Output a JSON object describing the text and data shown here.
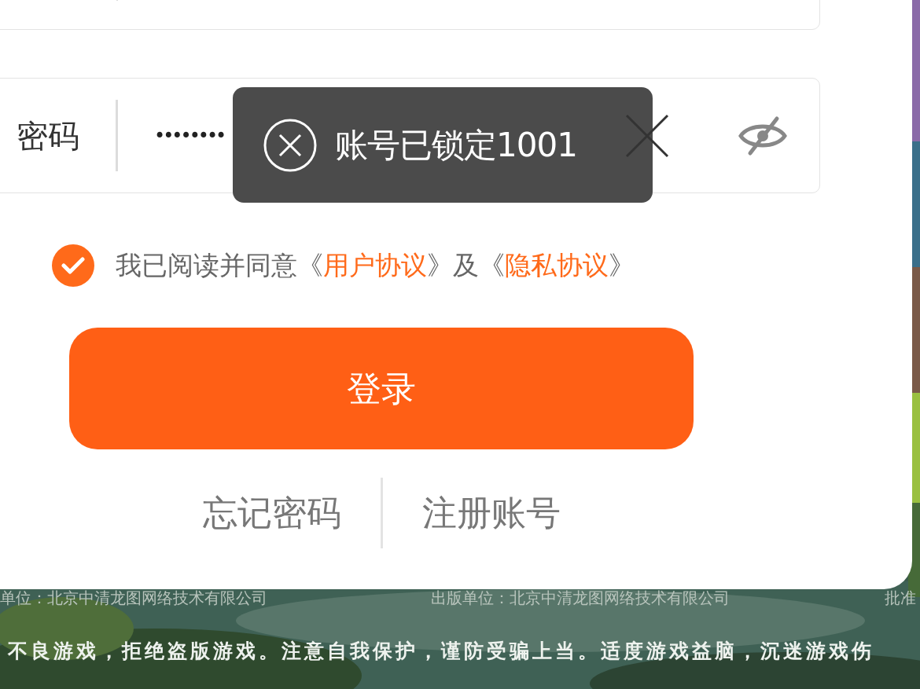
{
  "password_field": {
    "label": "密码",
    "value": "••••••••",
    "password_visible": false
  },
  "toast": {
    "message": "账号已锁定1001"
  },
  "agreement": {
    "checked": true,
    "parts": [
      {
        "kind": "text",
        "text": "我已阅读并同意《"
      },
      {
        "kind": "link",
        "text": "用户协议"
      },
      {
        "kind": "text",
        "text": "》及《"
      },
      {
        "kind": "link",
        "text": "隐私协议"
      },
      {
        "kind": "text",
        "text": "》"
      }
    ]
  },
  "login_button": "登录",
  "links": [
    "忘记密码",
    "注册账号"
  ],
  "footer": {
    "publisher_line": [
      "单位：北京中清龙图网络技术有限公司",
      "出版单位：北京中清龙图网络技术有限公司",
      "批准"
    ],
    "notice": "不良游戏，拒绝盗版游戏。注意自我保护，谨防受骗上当。适度游戏益脑，沉迷游戏伤"
  }
}
